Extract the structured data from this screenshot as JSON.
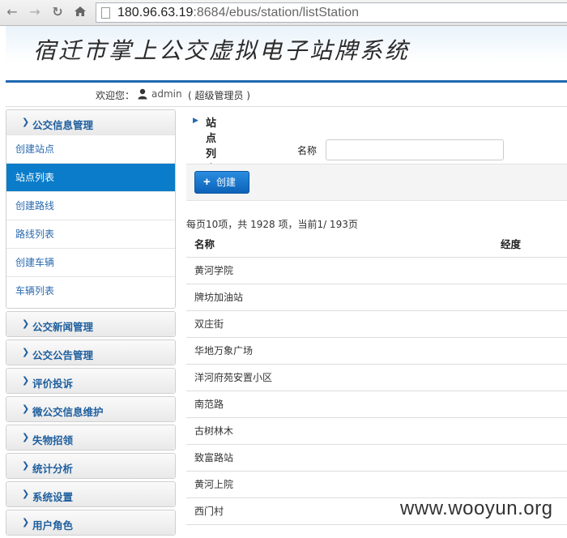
{
  "browser": {
    "url_host": "180.96.63.19",
    "url_rest": ":8684/ebus/station/listStation"
  },
  "header": {
    "title": "宿迁市掌上公交虚拟电子站牌系统"
  },
  "welcome": {
    "label": "欢迎您：",
    "user": "admin",
    "role": "( 超级管理员 )"
  },
  "sidebar": {
    "groups": [
      {
        "label": "公交信息管理",
        "items": [
          {
            "label": "创建站点",
            "active": false
          },
          {
            "label": "站点列表",
            "active": true
          },
          {
            "label": "创建路线",
            "active": false
          },
          {
            "label": "路线列表",
            "active": false
          },
          {
            "label": "创建车辆",
            "active": false
          },
          {
            "label": "车辆列表",
            "active": false
          }
        ]
      },
      {
        "label": "公交新闻管理"
      },
      {
        "label": "公交公告管理"
      },
      {
        "label": "评价投诉"
      },
      {
        "label": "微公交信息维护"
      },
      {
        "label": "失物招领"
      },
      {
        "label": "统计分析"
      },
      {
        "label": "系统设置"
      },
      {
        "label": "用户角色"
      }
    ]
  },
  "main": {
    "section_title": "站点列表",
    "search": {
      "label": "名称",
      "value": ""
    },
    "create_button": "创建",
    "pager": "每页10项，共 1928 项，当前1/ 193页",
    "table": {
      "headers": [
        "名称",
        "经度"
      ],
      "rows": [
        [
          "黄河学院",
          ""
        ],
        [
          "牌坊加油站",
          ""
        ],
        [
          "双庄街",
          ""
        ],
        [
          "华地万象广场",
          ""
        ],
        [
          "洋河府苑安置小区",
          ""
        ],
        [
          "南范路",
          ""
        ],
        [
          "古树林木",
          ""
        ],
        [
          "致富路站",
          ""
        ],
        [
          "黄河上院",
          ""
        ],
        [
          "西门村",
          ""
        ]
      ]
    }
  },
  "watermark": "www.wooyun.org",
  "colors": {
    "accent": "#0a7cc9",
    "header_line": "#1f69b1",
    "link": "#2a6ab0"
  }
}
